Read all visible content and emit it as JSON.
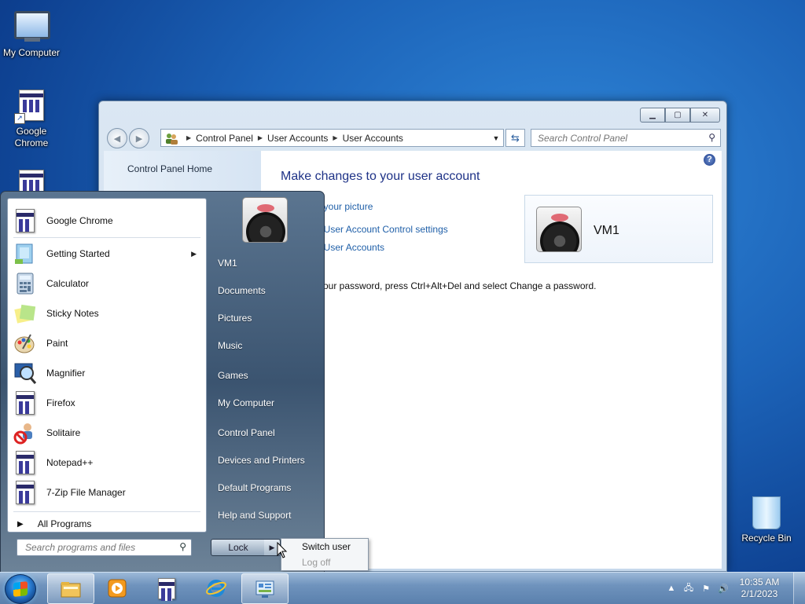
{
  "desktop": {
    "icons": [
      {
        "label": "My Computer"
      },
      {
        "label": "Google Chrome"
      },
      {
        "label": "Recycle Bin"
      }
    ]
  },
  "window": {
    "breadcrumb": [
      "Control Panel",
      "User Accounts",
      "User Accounts"
    ],
    "search_placeholder": "Search Control Panel",
    "left_nav": {
      "home": "Control Panel Home"
    },
    "heading": "Make changes to your user account",
    "links": [
      "ge your picture",
      "ge User Account Control settings",
      "ge User Accounts"
    ],
    "password_note": "e your password, press Ctrl+Alt+Del and select Change a password.",
    "user": {
      "name": "VM1"
    },
    "help_glyph": "?"
  },
  "start_menu": {
    "programs": [
      {
        "label": "Google Chrome",
        "icon": "chrome-app-icon",
        "submenu": false
      },
      {
        "label": "Getting Started",
        "icon": "getting-started-icon",
        "submenu": true
      },
      {
        "label": "Calculator",
        "icon": "calculator-icon",
        "submenu": false
      },
      {
        "label": "Sticky Notes",
        "icon": "sticky-notes-icon",
        "submenu": false
      },
      {
        "label": "Paint",
        "icon": "paint-icon",
        "submenu": false
      },
      {
        "label": "Magnifier",
        "icon": "magnifier-icon",
        "submenu": false
      },
      {
        "label": "Firefox",
        "icon": "firefox-app-icon",
        "submenu": false
      },
      {
        "label": "Solitaire",
        "icon": "solitaire-icon",
        "submenu": false
      },
      {
        "label": "Notepad++",
        "icon": "notepad-app-icon",
        "submenu": false
      },
      {
        "label": "7-Zip File Manager",
        "icon": "7zip-app-icon",
        "submenu": false
      }
    ],
    "all_programs": "All Programs",
    "search_placeholder": "Search programs and files",
    "right_items": [
      "VM1",
      "Documents",
      "Pictures",
      "Music",
      "Games",
      "My Computer",
      "Control Panel",
      "Devices and Printers",
      "Default Programs",
      "Help and Support"
    ],
    "lock_label": "Lock",
    "power_menu": {
      "switch_user": "Switch user",
      "log_off": "Log off"
    }
  },
  "taskbar": {
    "time": "10:35 AM",
    "date": "2/1/2023"
  },
  "colors": {
    "link": "#1f5fa8",
    "heading": "#1e3287",
    "desktop": "#1c63b8"
  }
}
